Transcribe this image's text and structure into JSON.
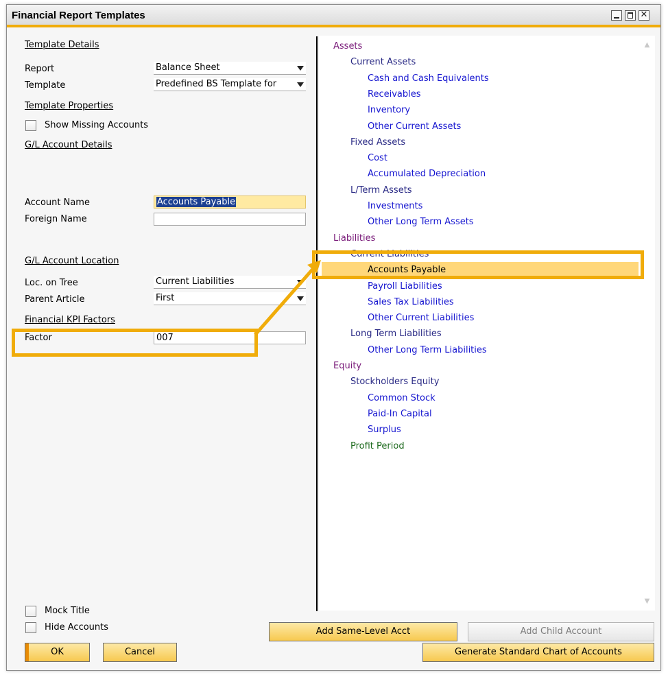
{
  "window": {
    "title": "Financial Report Templates"
  },
  "left": {
    "template_details_heading": "Template Details",
    "report_label": "Report",
    "report_value": "Balance Sheet",
    "template_label": "Template",
    "template_value": "Predefined BS Template for",
    "template_properties_heading": "Template Properties",
    "show_missing_accounts_label": "Show Missing Accounts",
    "gl_account_details_heading": "G/L Account Details",
    "account_name_label": "Account Name",
    "account_name_value": "Accounts Payable",
    "foreign_name_label": "Foreign Name",
    "foreign_name_value": "",
    "gl_account_location_heading": "G/L Account Location",
    "loc_on_tree_label": "Loc. on Tree",
    "loc_on_tree_value": "Current Liabilities",
    "parent_article_label": "Parent Article",
    "parent_article_value": "First",
    "financial_kpi_heading": "Financial KPI Factors",
    "factor_label": "Factor",
    "factor_value": "007",
    "mock_title_label": "Mock Title",
    "hide_accounts_label": "Hide Accounts"
  },
  "tree": {
    "items": [
      {
        "label": "Assets",
        "level": 0,
        "color": "purple"
      },
      {
        "label": "Current Assets",
        "level": 1,
        "color": "navy"
      },
      {
        "label": "Cash and Cash Equivalents",
        "level": 2,
        "color": "blue"
      },
      {
        "label": "Receivables",
        "level": 2,
        "color": "blue"
      },
      {
        "label": "Inventory",
        "level": 2,
        "color": "blue"
      },
      {
        "label": "Other Current Assets",
        "level": 2,
        "color": "blue"
      },
      {
        "label": "Fixed Assets",
        "level": 1,
        "color": "navy"
      },
      {
        "label": "Cost",
        "level": 2,
        "color": "blue"
      },
      {
        "label": "Accumulated Depreciation",
        "level": 2,
        "color": "blue"
      },
      {
        "label": "L/Term Assets",
        "level": 1,
        "color": "navy"
      },
      {
        "label": "Investments",
        "level": 2,
        "color": "blue"
      },
      {
        "label": "Other Long Term Assets",
        "level": 2,
        "color": "blue"
      },
      {
        "label": "Liabilities",
        "level": 0,
        "color": "purple"
      },
      {
        "label": "Current Liabilities",
        "level": 1,
        "color": "navy"
      },
      {
        "label": "Accounts Payable",
        "level": 2,
        "color": "blue",
        "selected": true
      },
      {
        "label": "Payroll Liabilities",
        "level": 2,
        "color": "blue"
      },
      {
        "label": "Sales Tax Liabilities",
        "level": 2,
        "color": "blue"
      },
      {
        "label": "Other Current Liabilities",
        "level": 2,
        "color": "blue"
      },
      {
        "label": "Long Term Liabilities",
        "level": 1,
        "color": "navy"
      },
      {
        "label": "Other Long Term Liabilities",
        "level": 2,
        "color": "blue"
      },
      {
        "label": "Equity",
        "level": 0,
        "color": "purple"
      },
      {
        "label": "Stockholders Equity",
        "level": 1,
        "color": "navy"
      },
      {
        "label": "Common Stock",
        "level": 2,
        "color": "blue"
      },
      {
        "label": "Paid-In Capital",
        "level": 2,
        "color": "blue"
      },
      {
        "label": "Surplus",
        "level": 2,
        "color": "blue"
      },
      {
        "label": "Profit Period",
        "level": 1,
        "color": "green"
      }
    ]
  },
  "buttons": {
    "ok": "OK",
    "cancel": "Cancel",
    "add_same_level": "Add Same-Level Acct",
    "add_child": "Add Child Account",
    "generate": "Generate Standard Chart of Accounts"
  },
  "colors": {
    "accent": "#f0ac0a",
    "selected": "#ffd77a"
  }
}
